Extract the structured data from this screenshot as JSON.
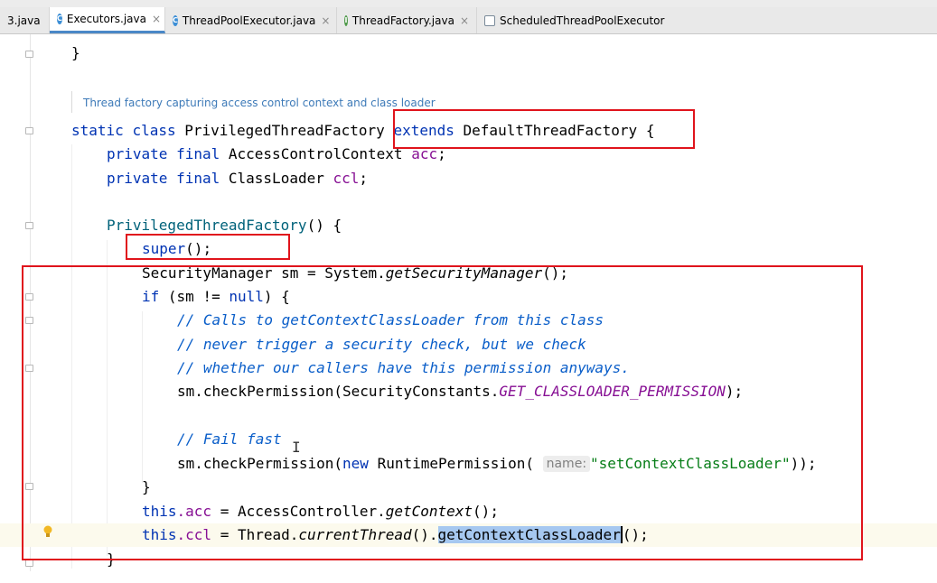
{
  "tabs": [
    {
      "label": "3.java",
      "icon": "none",
      "closable": false,
      "active": false
    },
    {
      "label": "Executors.java",
      "icon": "class",
      "closable": true,
      "active": true
    },
    {
      "label": "ThreadPoolExecutor.java",
      "icon": "class",
      "closable": true,
      "active": false
    },
    {
      "label": "ThreadFactory.java",
      "icon": "interface",
      "closable": true,
      "active": false
    },
    {
      "label": "ScheduledThreadPoolExecutor",
      "icon": "structure",
      "closable": false,
      "active": false
    }
  ],
  "doc_comment": "Thread factory capturing access control context and class loader",
  "code": {
    "l1_brace": "}",
    "l3_kw1": "static",
    "l3_kw2": "class",
    "l3_name": "PrivilegedThreadFactory",
    "l3_extends": "extends",
    "l3_super": "DefaultThreadFactory",
    "l3_brace": "{",
    "l4_kw1": "private",
    "l4_kw2": "final",
    "l4_type": "AccessControlContext",
    "l4_field": "acc",
    "l5_kw1": "private",
    "l5_kw2": "final",
    "l5_type": "ClassLoader",
    "l5_field": "ccl",
    "l6_ctor": "PrivilegedThreadFactory",
    "l6_rest": "() {",
    "l7_super": "super",
    "l7_rest": "();",
    "l8_a": "SecurityManager sm = System.",
    "l8_m": "getSecurityManager",
    "l8_b": "();",
    "l9_if": "if",
    "l9_a": " (sm != ",
    "l9_null": "null",
    "l9_b": ") {",
    "c1": "// Calls to getContextClassLoader from this class",
    "c2": "// never trigger a security check, but we check",
    "c3": "// whether our callers have this permission anyways.",
    "l10_a": "sm.checkPermission(SecurityConstants.",
    "l10_const": "GET_CLASSLOADER_PERMISSION",
    "l10_b": ");",
    "c4": "// Fail fast",
    "l11_a": "sm.checkPermission(",
    "l11_new": "new",
    "l11_b": " RuntimePermission(",
    "l11_hint": "name:",
    "l11_str": "\"setContextClassLoader\"",
    "l11_c": "));",
    "l12_brace": "}",
    "l13_this": "this",
    "l13_fld": ".acc",
    "l13_a": " = AccessController.",
    "l13_m": "getContext",
    "l13_b": "();",
    "l14_this": "this",
    "l14_fld": ".ccl",
    "l14_a": " = Thread.",
    "l14_m": "currentThread",
    "l14_b": "().",
    "l14_sel": "getContextClassLoader",
    "l14_c": "();",
    "l15_brace": "}"
  },
  "colors": {
    "keyword": "#0033b3",
    "field": "#871094",
    "comment": "#0a5ec9",
    "string": "#067d17",
    "annotation_box": "#e0141c",
    "selection": "#a6c8f0"
  }
}
